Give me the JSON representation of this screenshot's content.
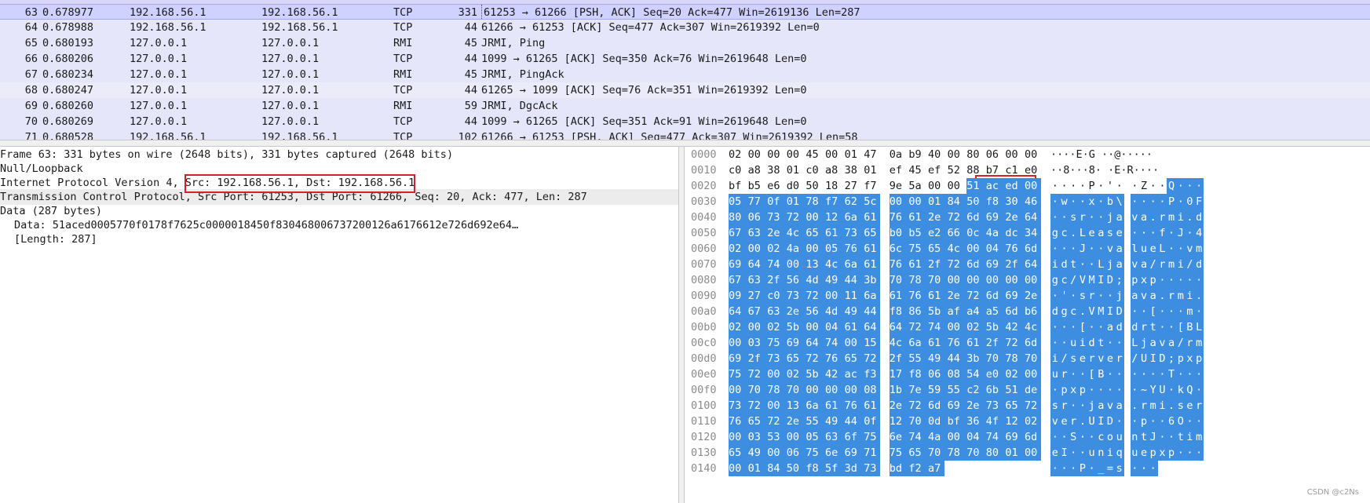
{
  "packets": [
    {
      "no": "63",
      "time": "0.678977",
      "src": "192.168.56.1",
      "dst": "192.168.56.1",
      "proto": "TCP",
      "len": "331",
      "info": "61253 → 61266 [PSH, ACK] Seq=20 Ack=477 Win=2619136 Len=287"
    },
    {
      "no": "64",
      "time": "0.678988",
      "src": "192.168.56.1",
      "dst": "192.168.56.1",
      "proto": "TCP",
      "len": "44",
      "info": "61266 → 61253 [ACK] Seq=477 Ack=307 Win=2619392 Len=0"
    },
    {
      "no": "65",
      "time": "0.680193",
      "src": "127.0.0.1",
      "dst": "127.0.0.1",
      "proto": "RMI",
      "len": "45",
      "info": "JRMI, Ping"
    },
    {
      "no": "66",
      "time": "0.680206",
      "src": "127.0.0.1",
      "dst": "127.0.0.1",
      "proto": "TCP",
      "len": "44",
      "info": "1099 → 61265 [ACK] Seq=350 Ack=76 Win=2619648 Len=0"
    },
    {
      "no": "67",
      "time": "0.680234",
      "src": "127.0.0.1",
      "dst": "127.0.0.1",
      "proto": "RMI",
      "len": "45",
      "info": "JRMI, PingAck"
    },
    {
      "no": "68",
      "time": "0.680247",
      "src": "127.0.0.1",
      "dst": "127.0.0.1",
      "proto": "TCP",
      "len": "44",
      "info": "61265 → 1099 [ACK] Seq=76 Ack=351 Win=2619392 Len=0"
    },
    {
      "no": "69",
      "time": "0.680260",
      "src": "127.0.0.1",
      "dst": "127.0.0.1",
      "proto": "RMI",
      "len": "59",
      "info": "JRMI, DgcAck"
    },
    {
      "no": "70",
      "time": "0.680269",
      "src": "127.0.0.1",
      "dst": "127.0.0.1",
      "proto": "TCP",
      "len": "44",
      "info": "1099 → 61265 [ACK] Seq=351 Ack=91 Win=2619648 Len=0"
    },
    {
      "no": "71",
      "time": "0.680528",
      "src": "192.168.56.1",
      "dst": "192.168.56.1",
      "proto": "TCP",
      "len": "102",
      "info": "61266 → 61253 [PSH, ACK] Seq=477 Ack=307 Win=2619392 Len=58"
    }
  ],
  "details": {
    "frame": "Frame 63: 331 bytes on wire (2648 bits), 331 bytes captured (2648 bits)",
    "loopback": "Null/Loopback",
    "ip": "Internet Protocol Version 4, Src: 192.168.56.1, Dst: 192.168.56.1",
    "tcp_prefix": "Transmission Control Protocol,",
    "tcp_ports": " Src Port: 61253, Dst Port: 61266, Se",
    "tcp_suffix": "q: 20, Ack: 477, Len: 287",
    "data": "Data (287 bytes)",
    "data_value": "Data: 51aced0005770f0178f7625c0000018450f830468006737200126a6176612e726d692e64…",
    "length": "[Length: 287]"
  },
  "hex": [
    {
      "off": "0000",
      "bytes": "02 00 00 00 45 00 01 47 0a b9 40 00 80 06 00 00",
      "ascii": "····E·G ··@·····",
      "sel_from": 16
    },
    {
      "off": "0010",
      "bytes": "c0 a8 38 01 c0 a8 38 01 ef 45 ef 52 88 b7 c1 e0",
      "ascii": "··8···8· ·E·R····",
      "sel_from": 16
    },
    {
      "off": "0020",
      "bytes": "bf b5 e6 d0 50 18 27 f7 9e 5a 00 00 51 ac ed 00",
      "ascii": "····P·'· ·Z··Q···",
      "sel_from": 12
    },
    {
      "off": "0030",
      "bytes": "05 77 0f 01 78 f7 62 5c 00 00 01 84 50 f8 30 46",
      "ascii": "·w··x·b\\ ····P·0F",
      "sel_from": 0
    },
    {
      "off": "0040",
      "bytes": "80 06 73 72 00 12 6a 61 76 61 2e 72 6d 69 2e 64",
      "ascii": "··sr··ja va.rmi.d",
      "sel_from": 0
    },
    {
      "off": "0050",
      "bytes": "67 63 2e 4c 65 61 73 65 b0 b5 e2 66 0c 4a dc 34",
      "ascii": "gc.Lease ···f·J·4",
      "sel_from": 0
    },
    {
      "off": "0060",
      "bytes": "02 00 02 4a 00 05 76 61 6c 75 65 4c 00 04 76 6d",
      "ascii": "···J··va lueL··vm",
      "sel_from": 0
    },
    {
      "off": "0070",
      "bytes": "69 64 74 00 13 4c 6a 61 76 61 2f 72 6d 69 2f 64",
      "ascii": "idt··Lja va/rmi/d",
      "sel_from": 0
    },
    {
      "off": "0080",
      "bytes": "67 63 2f 56 4d 49 44 3b 70 78 70 00 00 00 00 00",
      "ascii": "gc/VMID; pxp·····",
      "sel_from": 0
    },
    {
      "off": "0090",
      "bytes": "09 27 c0 73 72 00 11 6a 61 76 61 2e 72 6d 69 2e",
      "ascii": "·'·sr··j ava.rmi.",
      "sel_from": 0
    },
    {
      "off": "00a0",
      "bytes": "64 67 63 2e 56 4d 49 44 f8 86 5b af a4 a5 6d b6",
      "ascii": "dgc.VMID ··[···m·",
      "sel_from": 0
    },
    {
      "off": "00b0",
      "bytes": "02 00 02 5b 00 04 61 64 64 72 74 00 02 5b 42 4c",
      "ascii": "···[··ad drt··[BL",
      "sel_from": 0
    },
    {
      "off": "00c0",
      "bytes": "00 03 75 69 64 74 00 15 4c 6a 61 76 61 2f 72 6d",
      "ascii": "··uidt·· Ljava/rm",
      "sel_from": 0
    },
    {
      "off": "00d0",
      "bytes": "69 2f 73 65 72 76 65 72 2f 55 49 44 3b 70 78 70",
      "ascii": "i/server /UID;pxp",
      "sel_from": 0
    },
    {
      "off": "00e0",
      "bytes": "75 72 00 02 5b 42 ac f3 17 f8 06 08 54 e0 02 00",
      "ascii": "ur··[B·· ····T···",
      "sel_from": 0
    },
    {
      "off": "00f0",
      "bytes": "00 70 78 70 00 00 00 08 1b 7e 59 55 c2 6b 51 de",
      "ascii": "·pxp···· ·~YU·kQ·",
      "sel_from": 0
    },
    {
      "off": "0100",
      "bytes": "73 72 00 13 6a 61 76 61 2e 72 6d 69 2e 73 65 72",
      "ascii": "sr··java .rmi.ser",
      "sel_from": 0
    },
    {
      "off": "0110",
      "bytes": "76 65 72 2e 55 49 44 0f 12 70 0d bf 36 4f 12 02",
      "ascii": "ver.UID· ·p··6O··",
      "sel_from": 0
    },
    {
      "off": "0120",
      "bytes": "00 03 53 00 05 63 6f 75 6e 74 4a 00 04 74 69 6d",
      "ascii": "··S··cou ntJ··tim",
      "sel_from": 0
    },
    {
      "off": "0130",
      "bytes": "65 49 00 06 75 6e 69 71 75 65 70 78 70 80 01 00",
      "ascii": "eI··uniq uepxp···",
      "sel_from": 0
    },
    {
      "off": "0140",
      "bytes": "00 01 84 50 f8 5f 3d 73 bd f2 a7",
      "ascii": "···P·_=s ···",
      "sel_from": 0
    }
  ],
  "watermark": "CSDN @c2Ns",
  "colors": {
    "selection": "#3d8ee0",
    "selected_row": "#cfd2ff",
    "annotation": "#d61f26"
  }
}
